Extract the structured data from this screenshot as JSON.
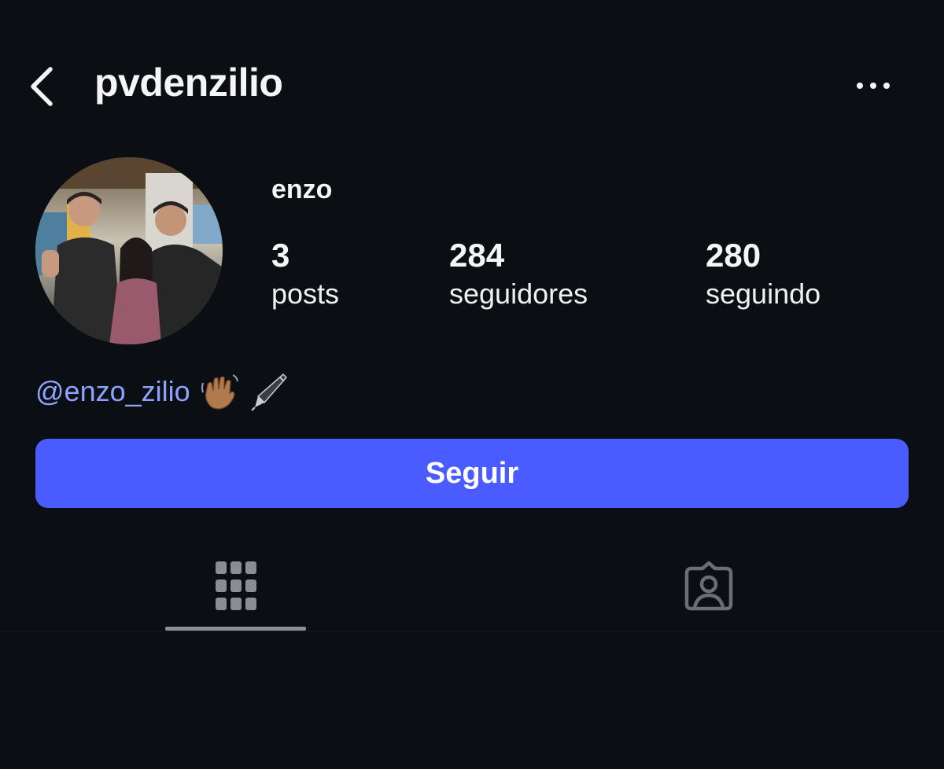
{
  "header": {
    "username": "pvdenzilio",
    "back_icon": "chevron-left-icon",
    "more_icon": "ellipsis-icon"
  },
  "profile": {
    "display_name": "enzo",
    "stats": [
      {
        "value": "3",
        "label": "posts"
      },
      {
        "value": "284",
        "label": "seguidores"
      },
      {
        "value": "280",
        "label": "seguindo"
      }
    ],
    "bio": {
      "link": "@enzo_zilio",
      "emojis": [
        "waving-hand-icon",
        "fountain-pen-icon"
      ]
    }
  },
  "actions": {
    "follow_label": "Seguir"
  },
  "tabs": [
    {
      "name": "posts-grid",
      "icon": "grid-icon",
      "active": true
    },
    {
      "name": "tagged",
      "icon": "tagged-person-icon",
      "active": false
    }
  ],
  "colors": {
    "background": "#0b0f14",
    "accent": "#4a5cff",
    "link": "#8ea3ff",
    "icon_muted": "#8a8d91"
  }
}
